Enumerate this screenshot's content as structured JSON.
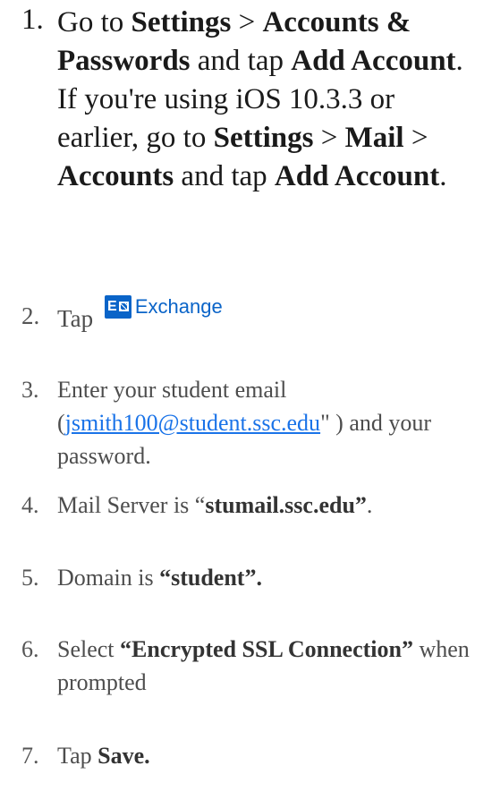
{
  "steps": [
    {
      "number": "1.",
      "t1": "Go to ",
      "b1": "Settings",
      "t2": " > ",
      "b2": "Accounts & Passwords",
      "t3": " and tap ",
      "b3": "Add Account",
      "t4": ". If you're using iOS 10.3.3 or earlier, go to ",
      "b4": "Settings",
      "t5": " > ",
      "b5": "Mail",
      "t6": " > ",
      "b6": "Accounts",
      "t7": " and tap ",
      "b7": "Add Account",
      "t8": "."
    },
    {
      "number": "2.",
      "t1": "Tap",
      "logo_box": "E",
      "logo_text": "Exchange",
      "logo_icon": "exchange-logo-icon"
    },
    {
      "number": "3.",
      "t1": "Enter your student email (",
      "link": "jsmith100@student.ssc.edu",
      "t2": "\" ) and your password."
    },
    {
      "number": "4.",
      "t1": "Mail Server is “",
      "b1": "stumail.ssc.edu”",
      "t2": "."
    },
    {
      "number": "5.",
      "t1": "Domain is ",
      "b1": "“student”."
    },
    {
      "number": "6.",
      "t1": "Select ",
      "b1": "“Encrypted SSL Connection”",
      "t2": " when prompted"
    },
    {
      "number": "7.",
      "t1": "Tap ",
      "b1": "Save."
    }
  ],
  "colors": {
    "text_dark": "#1a1a1a",
    "text_gray": "#4d4d4d",
    "link": "#1a73e8",
    "exchange_blue": "#0a64c8"
  }
}
